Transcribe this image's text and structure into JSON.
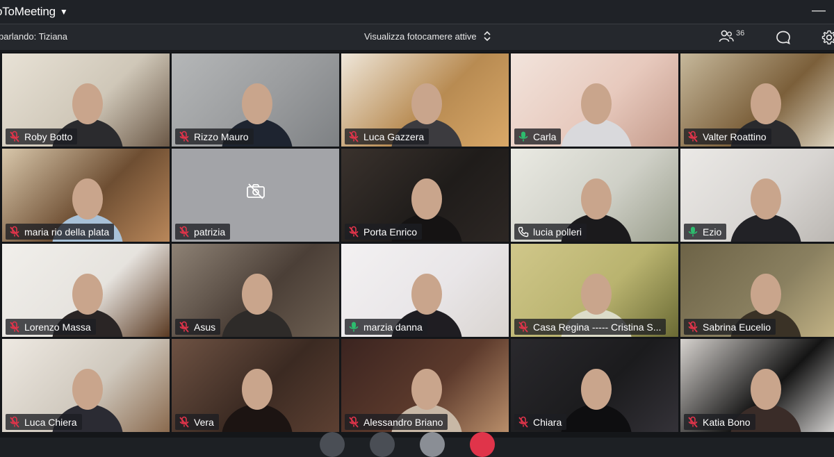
{
  "app": {
    "title": "oToMeeting"
  },
  "toolbar": {
    "speaking_label": "parlando: Tiziana",
    "camera_view_label": "Visualizza fotocamere attive",
    "attendee_count": "36"
  },
  "participants": [
    {
      "name": "Roby Botto",
      "audio": "muted"
    },
    {
      "name": "Rizzo Mauro",
      "audio": "muted"
    },
    {
      "name": "Luca Gazzera",
      "audio": "muted"
    },
    {
      "name": "Carla",
      "audio": "active"
    },
    {
      "name": "Valter Roattino",
      "audio": "muted"
    },
    {
      "name": "maria rio della plata",
      "audio": "muted"
    },
    {
      "name": "patrizia",
      "audio": "muted",
      "camera": "off"
    },
    {
      "name": "Porta Enrico",
      "audio": "muted"
    },
    {
      "name": "lucia polleri",
      "audio": "phone"
    },
    {
      "name": "Ezio",
      "audio": "active"
    },
    {
      "name": "Lorenzo Massa",
      "audio": "muted"
    },
    {
      "name": "Asus",
      "audio": "muted"
    },
    {
      "name": "marzia danna",
      "audio": "active"
    },
    {
      "name": "Casa Regina ----- Cristina S...",
      "audio": "muted"
    },
    {
      "name": "Sabrina Eucelio",
      "audio": "muted"
    },
    {
      "name": "Luca Chiera",
      "audio": "muted"
    },
    {
      "name": "Vera",
      "audio": "muted"
    },
    {
      "name": "Alessandro Briano",
      "audio": "muted"
    },
    {
      "name": "Chiara",
      "audio": "muted"
    },
    {
      "name": "Katia Bono",
      "audio": "muted"
    }
  ],
  "colors": {
    "muted": "#e0344a",
    "active": "#2dbd6e",
    "phone": "#ffffff",
    "accent": "#ffffff"
  }
}
